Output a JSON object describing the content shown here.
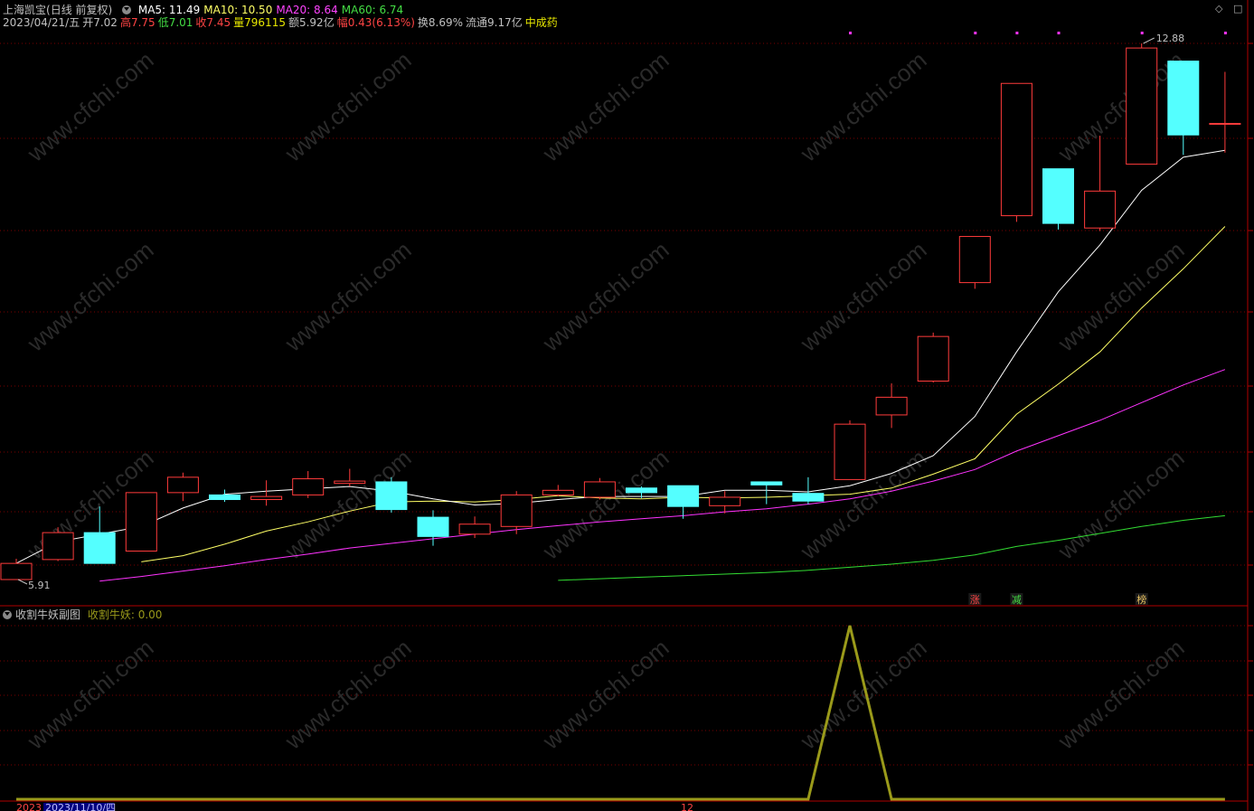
{
  "header": {
    "stock_name": "上海凯宝",
    "period": "(日线 前复权)",
    "ma_labels": [
      {
        "text": "MA5: 11.49",
        "color": "#ffffff"
      },
      {
        "text": "MA10: 10.50",
        "color": "#ffff66"
      },
      {
        "text": "MA20: 8.64",
        "color": "#ff44ff"
      },
      {
        "text": "MA60: 6.74",
        "color": "#44dd44"
      }
    ],
    "quote": [
      {
        "text": "2023/04/21/五",
        "color": "#c0c0c0"
      },
      {
        "text": "开7.02",
        "color": "#c0c0c0"
      },
      {
        "text": "高7.75",
        "color": "#ff4444"
      },
      {
        "text": "低7.01",
        "color": "#44dd44"
      },
      {
        "text": "收7.45",
        "color": "#ff4444"
      },
      {
        "text": "量796115",
        "color": "#e6e600"
      },
      {
        "text": "额5.92亿",
        "color": "#c0c0c0"
      },
      {
        "text": "幅0.43(6.13%)",
        "color": "#ff4444"
      },
      {
        "text": "换8.69%",
        "color": "#c0c0c0"
      },
      {
        "text": "流通9.17亿",
        "color": "#c0c0c0"
      },
      {
        "text": "中成药",
        "color": "#e6e600"
      }
    ],
    "window_controls": [
      "◇",
      "□"
    ]
  },
  "sub_header": {
    "title": "收割牛妖副图",
    "indicator": "收割牛妖: 0.00"
  },
  "annotations": {
    "high_label": "12.88",
    "low_label": "5.91",
    "markers": [
      {
        "text": "涨",
        "color": "#ff4444"
      },
      {
        "text": "减",
        "color": "#44dd44"
      },
      {
        "text": "榜",
        "color": "#e6c060"
      }
    ]
  },
  "footer": {
    "left": "2023",
    "date": "2023/11/10/四",
    "mid": "12"
  },
  "watermark": "www.cfchi.com",
  "colors": {
    "up": "#ff3b3b",
    "down": "#54ffff",
    "ma5": "#ffffff",
    "ma10": "#ffff66",
    "ma20": "#ff33ff",
    "ma60": "#33dd33",
    "indicator": "#9a9a1a",
    "grid": "#7a0000",
    "divider": "#b00000"
  },
  "chart_data": [
    {
      "type": "candlestick",
      "title": "上海凯宝(日线 前复权)",
      "candles": [
        {
          "o": 5.91,
          "h": 6.18,
          "l": 5.91,
          "c": 6.12
        },
        {
          "o": 6.17,
          "h": 6.59,
          "l": 6.15,
          "c": 6.52
        },
        {
          "o": 6.52,
          "h": 6.86,
          "l": 6.13,
          "c": 6.12
        },
        {
          "o": 6.28,
          "h": 7.04,
          "l": 6.28,
          "c": 7.04
        },
        {
          "o": 7.04,
          "h": 7.3,
          "l": 6.93,
          "c": 7.24
        },
        {
          "o": 7.01,
          "h": 7.08,
          "l": 6.92,
          "c": 6.95
        },
        {
          "o": 6.95,
          "h": 7.2,
          "l": 6.87,
          "c": 6.99
        },
        {
          "o": 7.01,
          "h": 7.32,
          "l": 6.97,
          "c": 7.22
        },
        {
          "o": 7.16,
          "h": 7.35,
          "l": 7.12,
          "c": 7.19
        },
        {
          "o": 7.18,
          "h": 7.24,
          "l": 6.78,
          "c": 6.82
        },
        {
          "o": 6.72,
          "h": 6.81,
          "l": 6.35,
          "c": 6.47
        },
        {
          "o": 6.5,
          "h": 6.73,
          "l": 6.45,
          "c": 6.63
        },
        {
          "o": 6.6,
          "h": 7.06,
          "l": 6.5,
          "c": 7.01
        },
        {
          "o": 7.01,
          "h": 7.14,
          "l": 6.99,
          "c": 7.07
        },
        {
          "o": 6.98,
          "h": 7.23,
          "l": 6.95,
          "c": 7.18
        },
        {
          "o": 7.1,
          "h": 7.12,
          "l": 6.97,
          "c": 7.04
        },
        {
          "o": 7.13,
          "h": 7.13,
          "l": 6.7,
          "c": 6.86
        },
        {
          "o": 6.87,
          "h": 7.06,
          "l": 6.77,
          "c": 6.98
        },
        {
          "o": 7.18,
          "h": 7.18,
          "l": 6.89,
          "c": 7.14
        },
        {
          "o": 7.03,
          "h": 7.24,
          "l": 6.89,
          "c": 6.93
        },
        {
          "o": 7.21,
          "h": 7.98,
          "l": 7.21,
          "c": 7.93
        },
        {
          "o": 8.05,
          "h": 8.46,
          "l": 7.88,
          "c": 8.28
        },
        {
          "o": 8.49,
          "h": 9.12,
          "l": 8.47,
          "c": 9.07
        },
        {
          "o": 9.77,
          "h": 10.37,
          "l": 9.69,
          "c": 10.37
        },
        {
          "o": 10.64,
          "h": 12.36,
          "l": 10.56,
          "c": 12.36
        },
        {
          "o": 11.25,
          "h": 11.25,
          "l": 10.46,
          "c": 10.54
        },
        {
          "o": 10.48,
          "h": 11.68,
          "l": 10.44,
          "c": 10.96
        },
        {
          "o": 11.31,
          "h": 12.88,
          "l": 11.31,
          "c": 12.82
        },
        {
          "o": 12.65,
          "h": 12.65,
          "l": 11.43,
          "c": 11.69
        },
        {
          "o": 11.84,
          "h": 12.51,
          "l": 11.46,
          "c": 11.84
        }
      ],
      "ma5": [
        6.12,
        6.4,
        6.5,
        6.6,
        6.84,
        7.02,
        7.06,
        7.09,
        7.12,
        7.06,
        6.96,
        6.88,
        6.9,
        6.95,
        6.99,
        6.99,
        6.99,
        7.07,
        7.07,
        7.05,
        7.13,
        7.29,
        7.52,
        8.03,
        8.87,
        9.65,
        10.26,
        10.97,
        11.4,
        11.49
      ],
      "ma10": [
        null,
        null,
        null,
        6.14,
        6.22,
        6.37,
        6.54,
        6.66,
        6.8,
        6.92,
        6.93,
        6.92,
        6.95,
        7.0,
        6.97,
        6.96,
        6.98,
        6.97,
        6.98,
        7.0,
        7.02,
        7.1,
        7.28,
        7.48,
        8.06,
        8.45,
        8.87,
        9.44,
        9.95,
        10.5
      ],
      "ma20": [
        null,
        null,
        5.89,
        5.95,
        6.02,
        6.09,
        6.17,
        6.24,
        6.32,
        6.38,
        6.44,
        6.5,
        6.56,
        6.61,
        6.66,
        6.7,
        6.74,
        6.79,
        6.83,
        6.89,
        6.96,
        7.06,
        7.19,
        7.34,
        7.58,
        7.78,
        7.98,
        8.21,
        8.44,
        8.64
      ],
      "ma60": [
        null,
        null,
        null,
        null,
        null,
        null,
        null,
        null,
        null,
        null,
        null,
        null,
        null,
        5.9,
        5.92,
        5.94,
        5.96,
        5.98,
        6.0,
        6.03,
        6.07,
        6.11,
        6.16,
        6.23,
        6.34,
        6.42,
        6.51,
        6.6,
        6.68,
        6.74
      ],
      "marker_positions": [
        23,
        24,
        27
      ],
      "top_marker_positions": [
        20,
        23,
        24,
        25,
        27,
        29
      ]
    },
    {
      "type": "line",
      "title": "收割牛妖副图",
      "series": [
        {
          "name": "收割牛妖",
          "values": [
            0,
            0,
            0,
            0,
            0,
            0,
            0,
            0,
            0,
            0,
            0,
            0,
            0,
            0,
            0,
            0,
            0,
            0,
            0,
            0,
            1,
            0,
            0,
            0,
            0,
            0,
            0,
            0,
            0,
            0
          ]
        }
      ]
    }
  ]
}
